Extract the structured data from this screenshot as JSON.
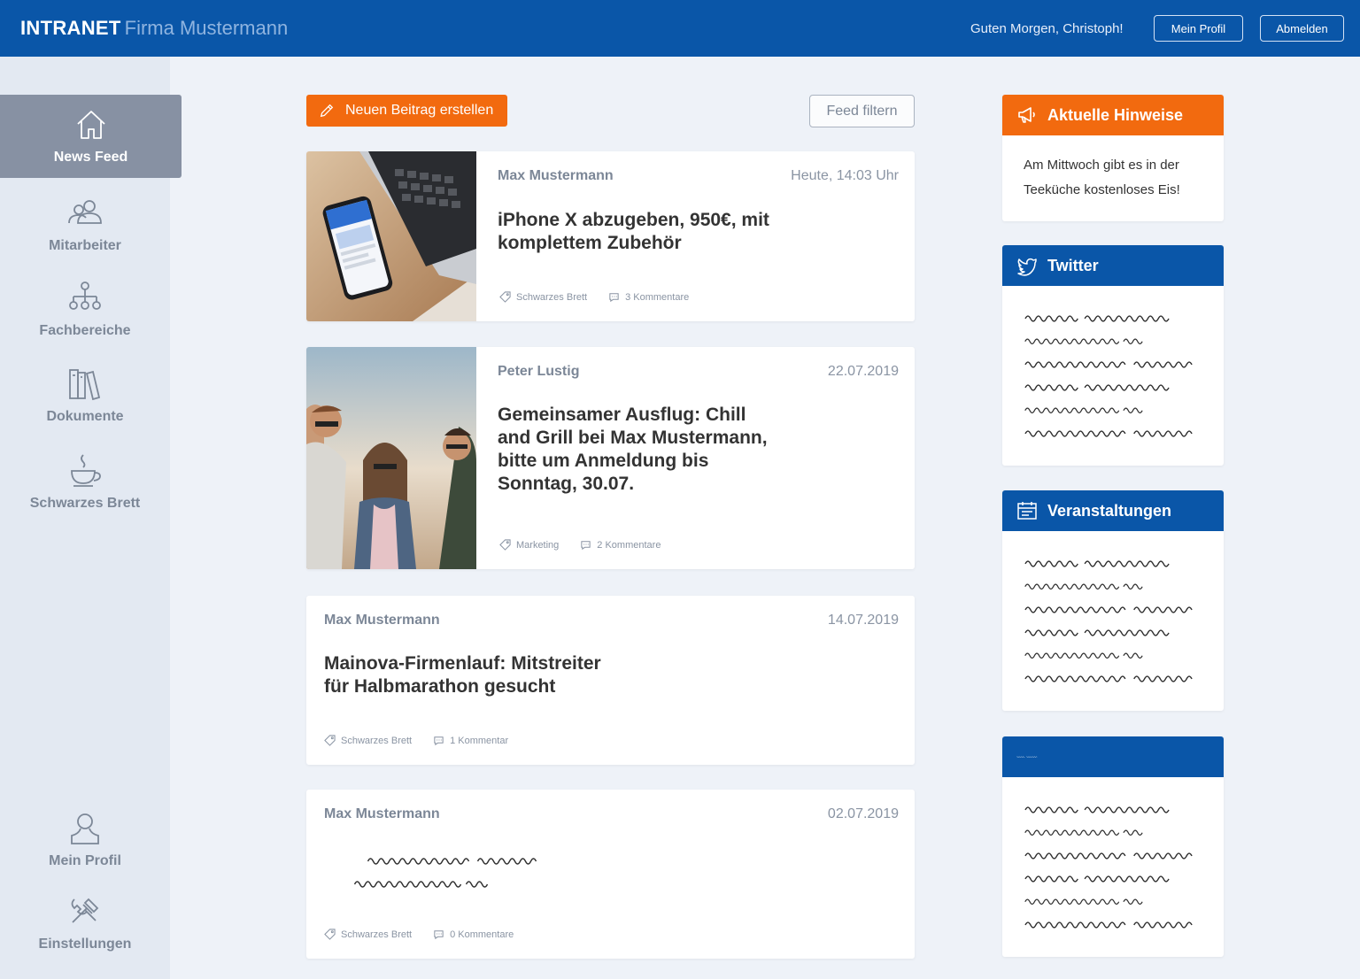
{
  "header": {
    "brand": "INTRANET",
    "company": "Firma Mustermann",
    "greeting": "Guten Morgen, Christoph!",
    "profile_button": "Mein Profil",
    "logout_button": "Abmelden"
  },
  "sidebar": {
    "items": [
      {
        "label": "News Feed",
        "icon": "home-icon"
      },
      {
        "label": "Mitarbeiter",
        "icon": "users-icon"
      },
      {
        "label": "Fachbereiche",
        "icon": "hierarchy-icon"
      },
      {
        "label": "Dokumente",
        "icon": "books-icon"
      },
      {
        "label": "Schwarzes Brett",
        "icon": "coffee-cup-icon"
      },
      {
        "label": "Mein Profil",
        "icon": "person-icon"
      },
      {
        "label": "Einstellungen",
        "icon": "tools-icon"
      }
    ],
    "active": "News Feed"
  },
  "actions": {
    "new_post": "Neuen Beitrag erstellen",
    "filter": "Feed filtern"
  },
  "posts": [
    {
      "author": "Max Mustermann",
      "date": "Heute, 14:03 Uhr",
      "title_lines": [
        "iPhone X abzugeben, 950€, mit",
        "komplettem Zubehör"
      ],
      "category": "Schwarzes Brett",
      "comments": "3 Kommentare",
      "image": "laptop-and-phone-photo"
    },
    {
      "author": "Peter Lustig",
      "date": "22.07.2019",
      "title_lines": [
        "Gemeinsamer Ausflug: Chill",
        "and Grill bei Max Mustermann,",
        "bitte um Anmeldung bis",
        "Sonntag, 30.07."
      ],
      "category": "Marketing",
      "comments": "2 Kommentare",
      "image": "people-outdoors-photo"
    },
    {
      "author": "Max Mustermann",
      "date": "14.07.2019",
      "title_lines": [
        "Mainova-Firmenlauf: Mitstreiter",
        "für Halbmarathon gesucht"
      ],
      "category": "Schwarzes Brett",
      "comments": "1 Kommentar"
    },
    {
      "author": "Max Mustermann",
      "date": "02.07.2019",
      "category": "Schwarzes Brett",
      "comments": "0 Kommentare"
    }
  ],
  "widgets": {
    "hinweise": {
      "title": "Aktuelle Hinweise",
      "text_lines": [
        "Am Mittwoch gibt es in der",
        "Teeküche kostenloses Eis!"
      ],
      "icon": "megaphone-icon"
    },
    "twitter": {
      "title": "Twitter",
      "icon": "twitter-bird-icon"
    },
    "events": {
      "title": "Veranstaltungen",
      "icon": "calendar-icon"
    }
  },
  "colors": {
    "primary_blue": "#0a56a8",
    "accent_orange": "#f26a0f",
    "background": "#eef2f8",
    "sidebar_bg": "#e3e9f2",
    "active_nav": "#8791a3",
    "muted_text": "#7c8797"
  }
}
